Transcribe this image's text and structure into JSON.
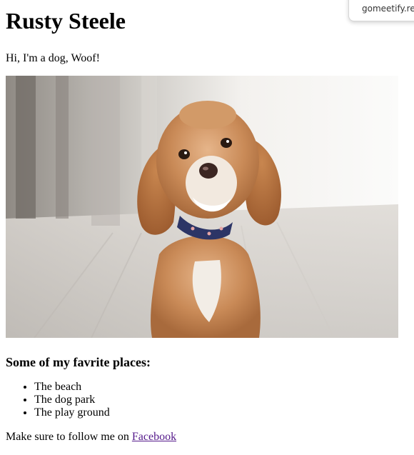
{
  "page": {
    "title": "Rusty Steele",
    "intro": "Hi, I'm a dog, Woof!",
    "places_heading": "Some of my favrite places:",
    "places": [
      "The beach",
      "The dog park",
      "The play ground"
    ],
    "follow_text": "Make sure to follow me on ",
    "follow_link": "Facebook"
  },
  "extension_popup": {
    "text": "gomeetify.revy"
  },
  "colors": {
    "link_visited": "#551a8b"
  }
}
